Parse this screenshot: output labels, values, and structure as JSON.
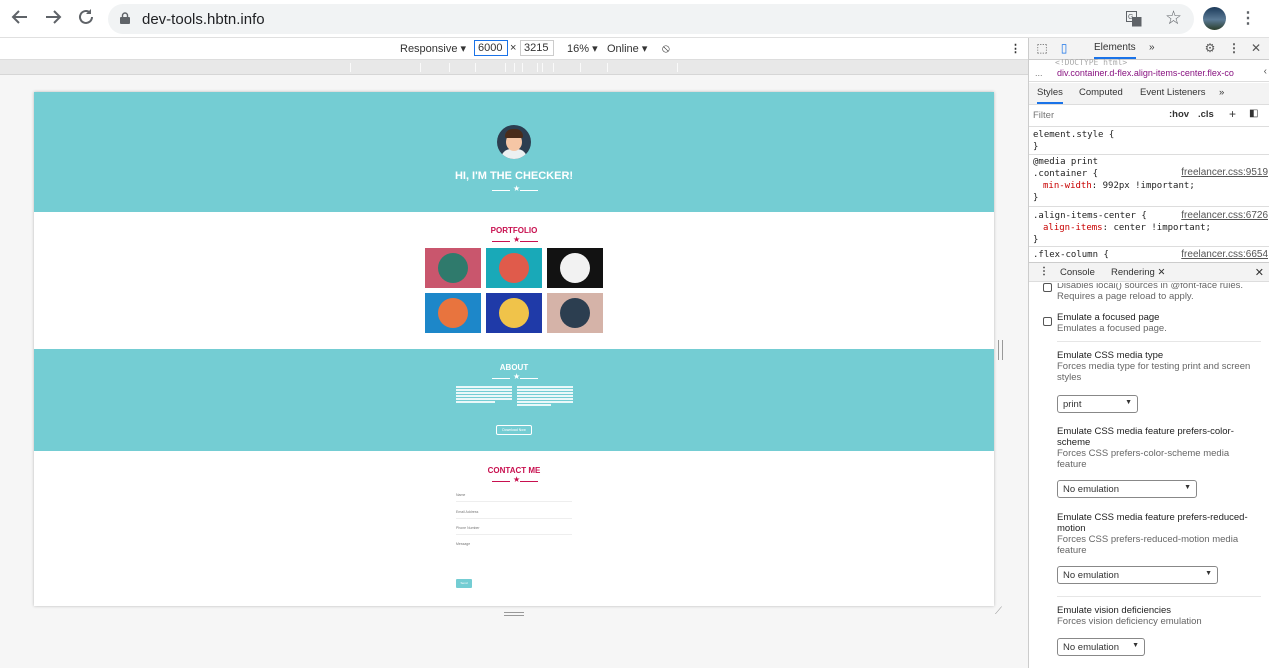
{
  "browser": {
    "url": "dev-tools.hbtn.info"
  },
  "device_toolbar": {
    "mode": "Responsive",
    "width": "6000",
    "times": "×",
    "height": "3215",
    "zoom": "16%",
    "network": "Online"
  },
  "site": {
    "hero_title": "HI, I'M THE CHECKER!",
    "portfolio_title": "PORTFOLIO",
    "portfolio_tiles": [
      {
        "bg": "#c9566d",
        "circle": "#2f7a6c",
        "icon": "cabin-icon"
      },
      {
        "bg": "#19a9b8",
        "circle": "#e05b4b",
        "icon": "cake-icon"
      },
      {
        "bg": "#121212",
        "circle": "#f2f2f2",
        "icon": "circus-tent-icon"
      },
      {
        "bg": "#1d87c9",
        "circle": "#e8743e",
        "icon": "game-controller-icon"
      },
      {
        "bg": "#1f3aa8",
        "circle": "#f0c34a",
        "icon": "safe-icon"
      },
      {
        "bg": "#d5b3a8",
        "circle": "#2c3e50",
        "icon": "submarine-icon"
      }
    ],
    "about_title": "ABOUT",
    "about_button": "Download Now",
    "contact_title": "CONTACT ME",
    "contact_fields": [
      "Name",
      "Email Address",
      "Phone Number",
      "Message"
    ],
    "send_label": "Send",
    "colors": {
      "primary": "#74cdd3",
      "accent": "#c8104f"
    }
  },
  "devtools": {
    "main_tabs": [
      "Elements",
      "»"
    ],
    "breadcrumb_ghost": "<!DOCTYPE html>",
    "breadcrumb_ellipsis": "...",
    "breadcrumb": "div.container.d-flex.align-items-center.flex-co",
    "sub_tabs": [
      "Styles",
      "Computed",
      "Event Listeners",
      "»"
    ],
    "filter_placeholder": "Filter",
    "hov": ":hov",
    "cls": ".cls",
    "rules": {
      "r1_sel": "element.style {",
      "r1_close": "}",
      "r2_media": "@media print",
      "r2_sel": ".container {",
      "r2_src": "freelancer.css:9519",
      "r2_prop": "min-width",
      "r2_val": ": 992px !important;",
      "r2_close": "}",
      "r3_sel": ".align-items-center {",
      "r3_src": "freelancer.css:6726",
      "r3_prop": "align-items",
      "r3_val": ": center !important;",
      "r3_close": "}",
      "r4_sel": ".flex-column {",
      "r4_src": "freelancer.css:6654"
    },
    "drawer_tabs": [
      "Console",
      "Rendering"
    ],
    "rendering": {
      "fontface_desc": "Disables local() sources in @font-face rules. Requires a page reload to apply.",
      "focus_title": "Emulate a focused page",
      "focus_desc": "Emulates a focused page.",
      "media_title": "Emulate CSS media type",
      "media_desc": "Forces media type for testing print and screen styles",
      "media_value": "print",
      "scheme_title": "Emulate CSS media feature prefers-color-scheme",
      "scheme_desc": "Forces CSS prefers-color-scheme media feature",
      "scheme_value": "No emulation",
      "motion_title": "Emulate CSS media feature prefers-reduced-motion",
      "motion_desc": "Forces CSS prefers-reduced-motion media feature",
      "motion_value": "No emulation",
      "vision_title": "Emulate vision deficiencies",
      "vision_desc": "Forces vision deficiency emulation",
      "vision_value": "No emulation"
    }
  }
}
